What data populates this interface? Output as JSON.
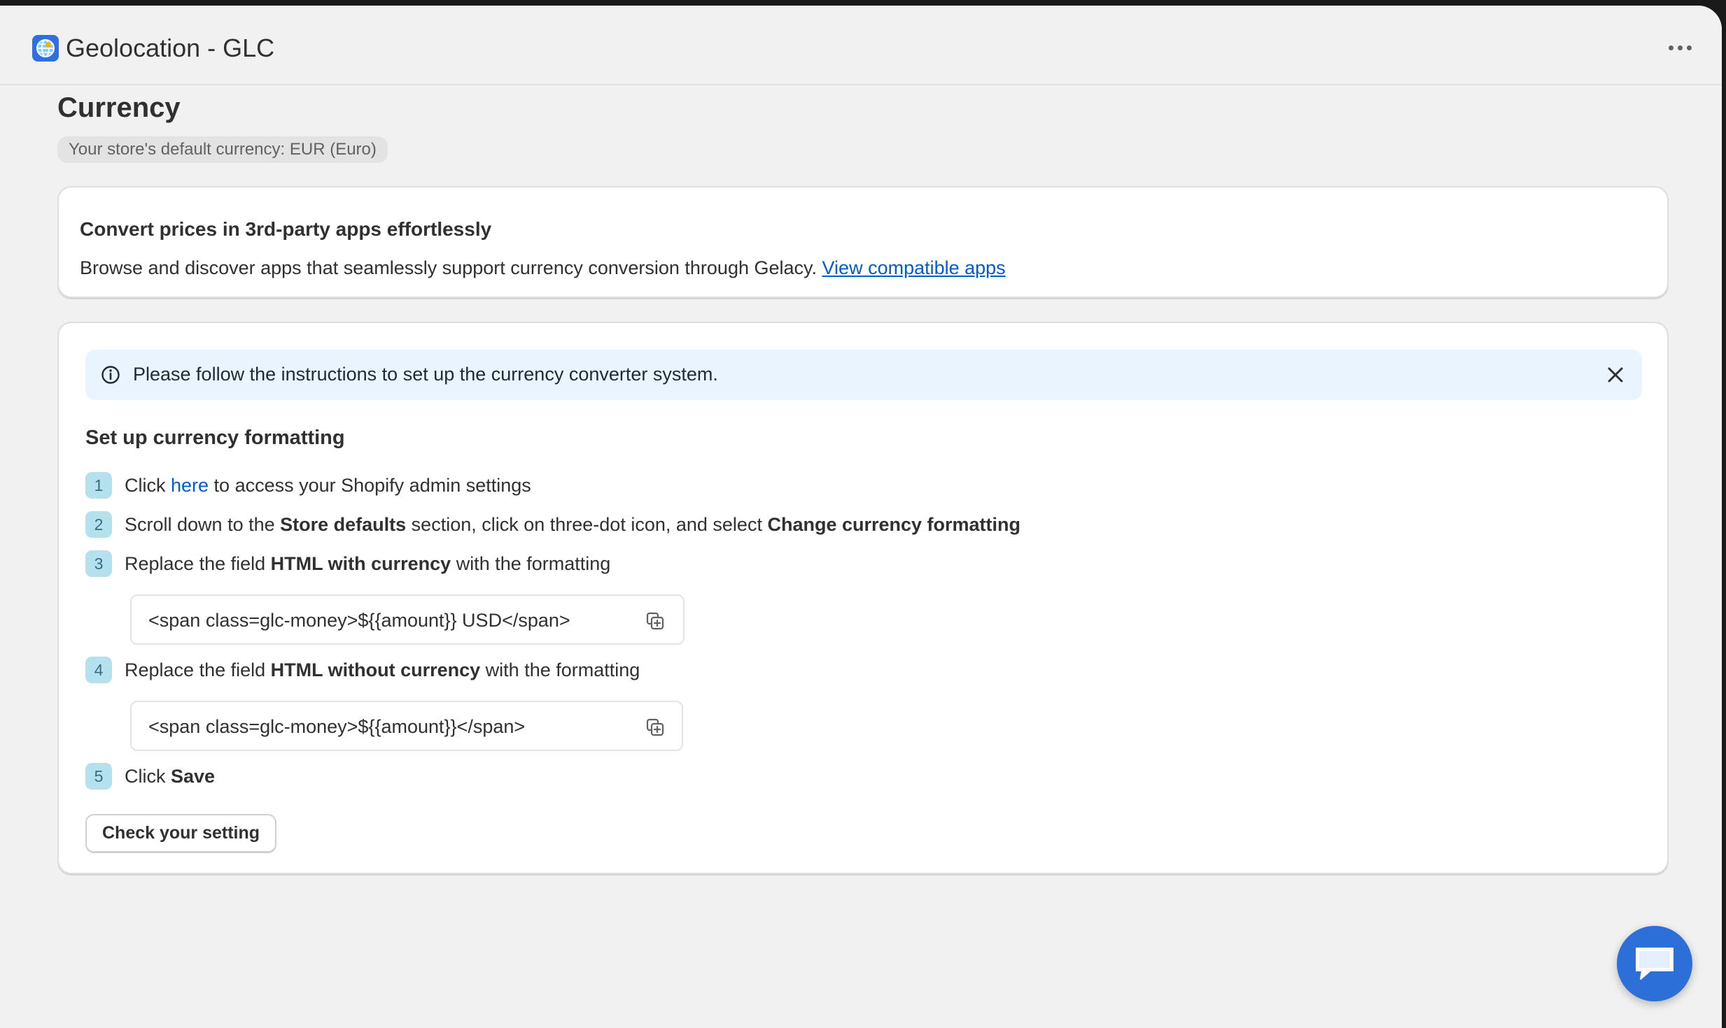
{
  "app": {
    "title": "Geolocation - GLC"
  },
  "page": {
    "title": "Currency",
    "default_currency_badge": "Your store's default currency: EUR (Euro)"
  },
  "promo_card": {
    "heading": "Convert prices in 3rd-party apps effortlessly",
    "body": "Browse and discover apps that seamlessly support currency conversion through Gelacy.",
    "link_label": "View compatible apps"
  },
  "setup_card": {
    "banner_message": "Please follow the instructions to set up the currency converter system.",
    "section_title": "Set up currency formatting",
    "steps": [
      {
        "number": "1",
        "pre": "Click ",
        "link": "here",
        "post": " to access your Shopify admin settings"
      },
      {
        "number": "2",
        "pre": "Scroll down to the ",
        "b1": "Store defaults",
        "mid": " section, click on three-dot icon, and select ",
        "b2": "Change currency formatting"
      },
      {
        "number": "3",
        "pre": "Replace the field ",
        "b1": "HTML with currency",
        "post": " with the formatting"
      },
      {
        "number": "4",
        "pre": "Replace the field ",
        "b1": "HTML without currency",
        "post": " with the formatting"
      },
      {
        "number": "5",
        "pre": "Click ",
        "b1": "Save"
      }
    ],
    "code_with_currency": "<span class=glc-money>${{amount}} USD</span>",
    "code_without_currency": "<span class=glc-money>${{amount}}</span>",
    "check_button": "Check your setting"
  },
  "icons": {
    "app": "globe-icon",
    "more": "more-horizontal-icon",
    "info": "info-icon",
    "close": "close-icon",
    "copy": "copy-icon",
    "chat": "chat-bubble-icon"
  },
  "colors": {
    "background": "#f1f1f1",
    "card": "#ffffff",
    "link": "#005bd3",
    "banner": "#eaf4ff",
    "step_badge": "#b4e1ed",
    "chat_button": "#2d6fd8"
  }
}
